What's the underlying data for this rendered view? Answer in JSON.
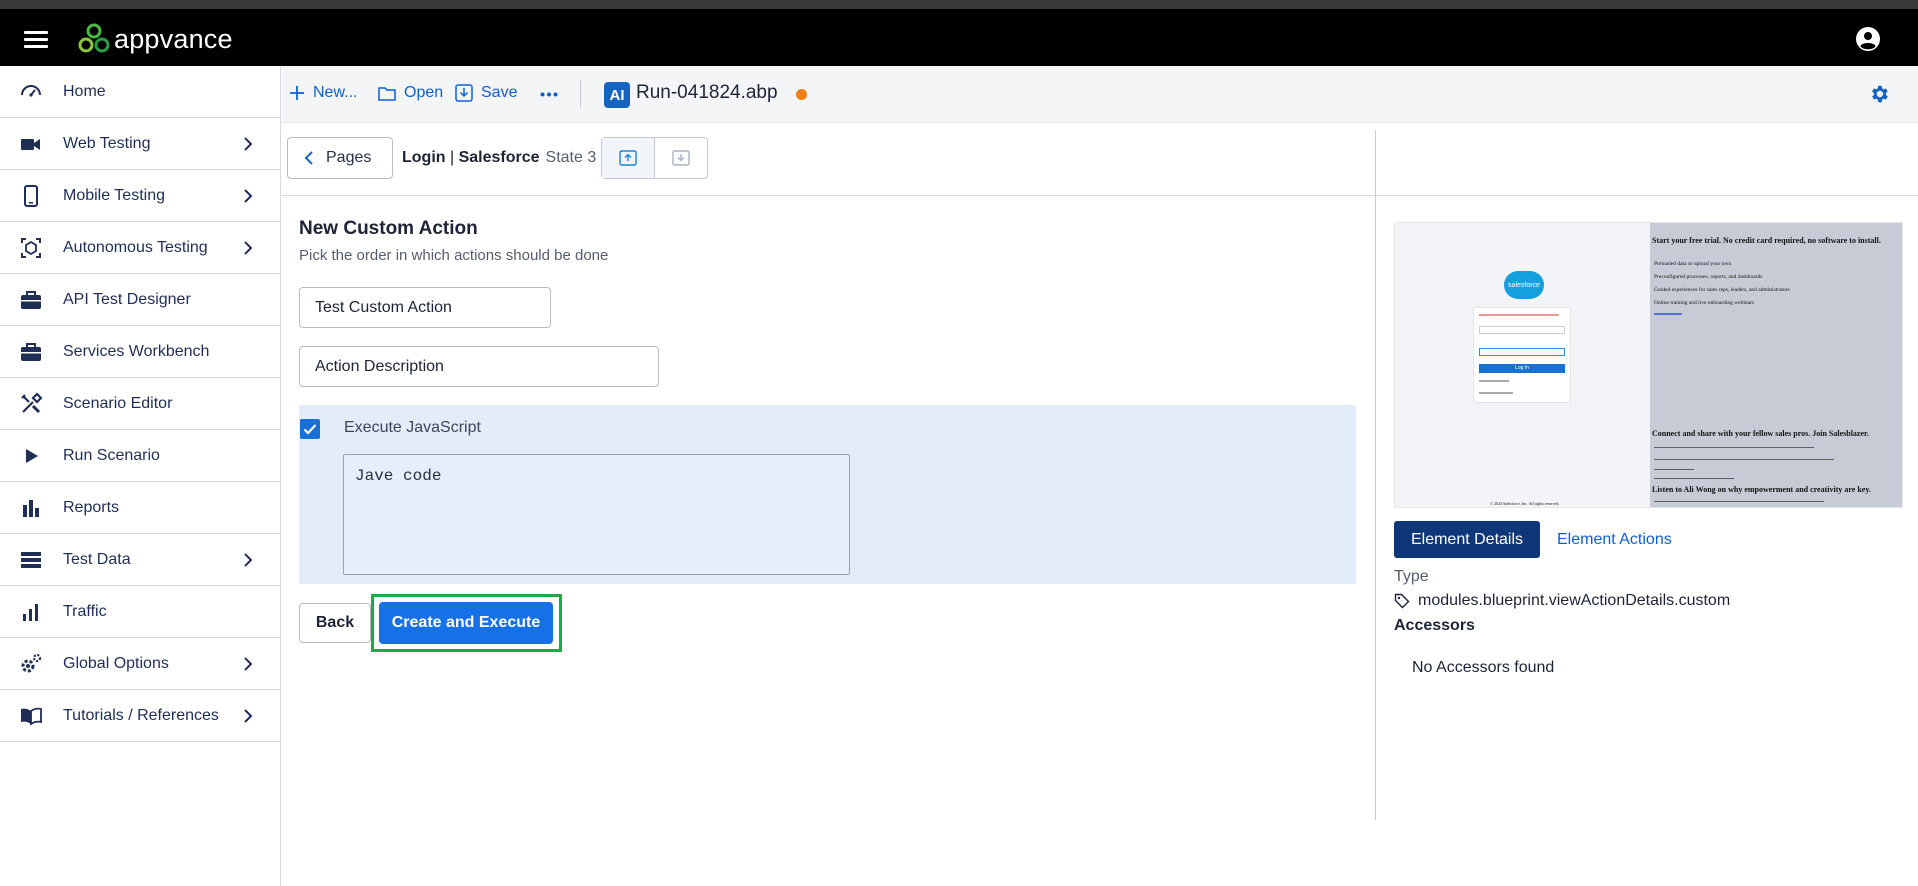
{
  "app": {
    "brand": "appvance"
  },
  "sidebar": {
    "items": [
      {
        "label": "Home",
        "icon": "speedometer-icon",
        "has_children": false
      },
      {
        "label": "Web Testing",
        "icon": "video-camera-icon",
        "has_children": true
      },
      {
        "label": "Mobile Testing",
        "icon": "mobile-phone-icon",
        "has_children": true
      },
      {
        "label": "Autonomous Testing",
        "icon": "cube-scan-icon",
        "has_children": true
      },
      {
        "label": "API Test Designer",
        "icon": "briefcase-icon",
        "has_children": false
      },
      {
        "label": "Services Workbench",
        "icon": "briefcase-icon",
        "has_children": false
      },
      {
        "label": "Scenario Editor",
        "icon": "tools-icon",
        "has_children": false
      },
      {
        "label": "Run Scenario",
        "icon": "play-icon",
        "has_children": false
      },
      {
        "label": "Reports",
        "icon": "bar-chart-icon",
        "has_children": false
      },
      {
        "label": "Test Data",
        "icon": "list-icon",
        "has_children": true
      },
      {
        "label": "Traffic",
        "icon": "signal-bars-icon",
        "has_children": false
      },
      {
        "label": "Global Options",
        "icon": "gears-icon",
        "has_children": true
      },
      {
        "label": "Tutorials / References",
        "icon": "book-icon",
        "has_children": true
      }
    ]
  },
  "toolbar": {
    "new_label": "New...",
    "open_label": "Open",
    "save_label": "Save",
    "ai_badge": "AI",
    "file_name": "Run-041824.abp",
    "dirty_color": "#f07e13"
  },
  "pagebar": {
    "pages_label": "Pages",
    "crumb_page": "Login",
    "crumb_sep": " | ",
    "crumb_site": "Salesforce",
    "state_label": "State 3"
  },
  "form": {
    "title": "New Custom Action",
    "subtitle": "Pick the order in which actions should be done",
    "name_value": "Test Custom Action",
    "description_value": "Action Description",
    "execute_js_label": "Execute JavaScript",
    "execute_js_checked": true,
    "code_value": "Jave code",
    "back_label": "Back",
    "create_label": "Create and Execute"
  },
  "details": {
    "preview": {
      "logo_text": "salesforce",
      "headline_1": "Start your free trial. No credit card required, no software to install.",
      "headline_2": "Connect and share with your fellow sales pros. Join Salesblazer.",
      "headline_3": "Listen to Ali Wong on why empowerment and creativity are key.",
      "bullets": [
        "Preloaded data or upload your own",
        "Preconfigured processes, reports, and dashboards",
        "Guided experiences for sales reps, leaders, and administrators",
        "Online training and live onboarding webinars"
      ],
      "login_button": "Log In",
      "footer": "© 2024 Salesforce, Inc. All rights reserved."
    },
    "tab_details": "Element Details",
    "tab_actions": "Element Actions",
    "type_label": "Type",
    "type_value": "modules.blueprint.viewActionDetails.custom",
    "accessors_label": "Accessors",
    "no_accessors": "No Accessors found"
  },
  "colors": {
    "primary": "#1670e8",
    "navy": "#0e3779",
    "highlight": "#1fa84a",
    "sidebar_text": "#1f2e54"
  }
}
